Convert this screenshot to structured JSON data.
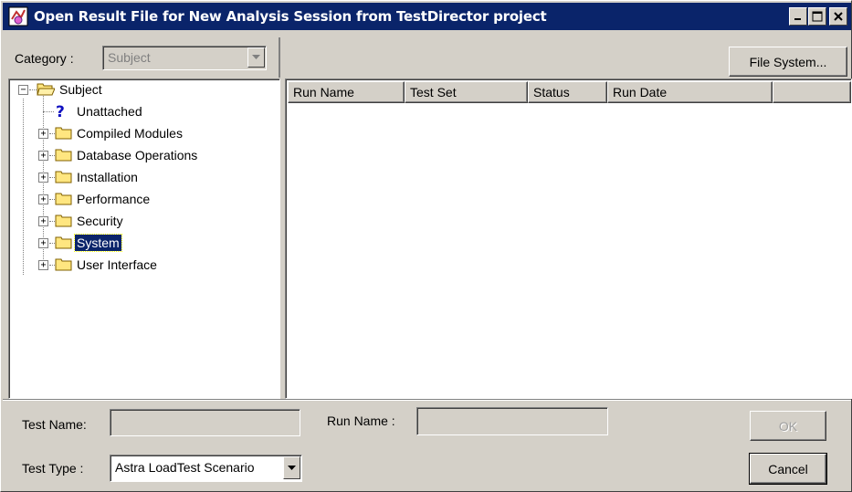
{
  "window": {
    "title": "Open Result File for New Analysis Session  from TestDirector project",
    "title_bar_color": "#0a246a",
    "icon": "analysis-app-icon"
  },
  "category": {
    "label": "Category :",
    "value": "Subject"
  },
  "file_system_button": "File System...",
  "tree": {
    "root": "Subject",
    "items": [
      {
        "label": "Unattached",
        "icon": "question-icon"
      },
      {
        "label": "Compiled Modules",
        "icon": "folder-icon"
      },
      {
        "label": "Database Operations",
        "icon": "folder-icon"
      },
      {
        "label": "Installation",
        "icon": "folder-icon"
      },
      {
        "label": "Performance",
        "icon": "folder-icon"
      },
      {
        "label": "Security",
        "icon": "folder-icon"
      },
      {
        "label": "System",
        "icon": "folder-icon",
        "selected": true
      },
      {
        "label": "User Interface",
        "icon": "folder-icon"
      }
    ]
  },
  "runs_table": {
    "columns": [
      "Run Name",
      "Test Set",
      "Status",
      "Run Date",
      ""
    ],
    "rows": []
  },
  "form": {
    "test_name_label": "Test Name:",
    "test_name_value": "",
    "run_name_label": "Run Name :",
    "run_name_value": "",
    "test_type_label": "Test Type :",
    "test_type_value": "Astra LoadTest Scenario"
  },
  "buttons": {
    "ok": "OK",
    "cancel": "Cancel"
  },
  "colors": {
    "selection": "#0a246a",
    "face": "#d4d0c8",
    "question_mark": "#1010c0",
    "folder": "#ffe680"
  }
}
